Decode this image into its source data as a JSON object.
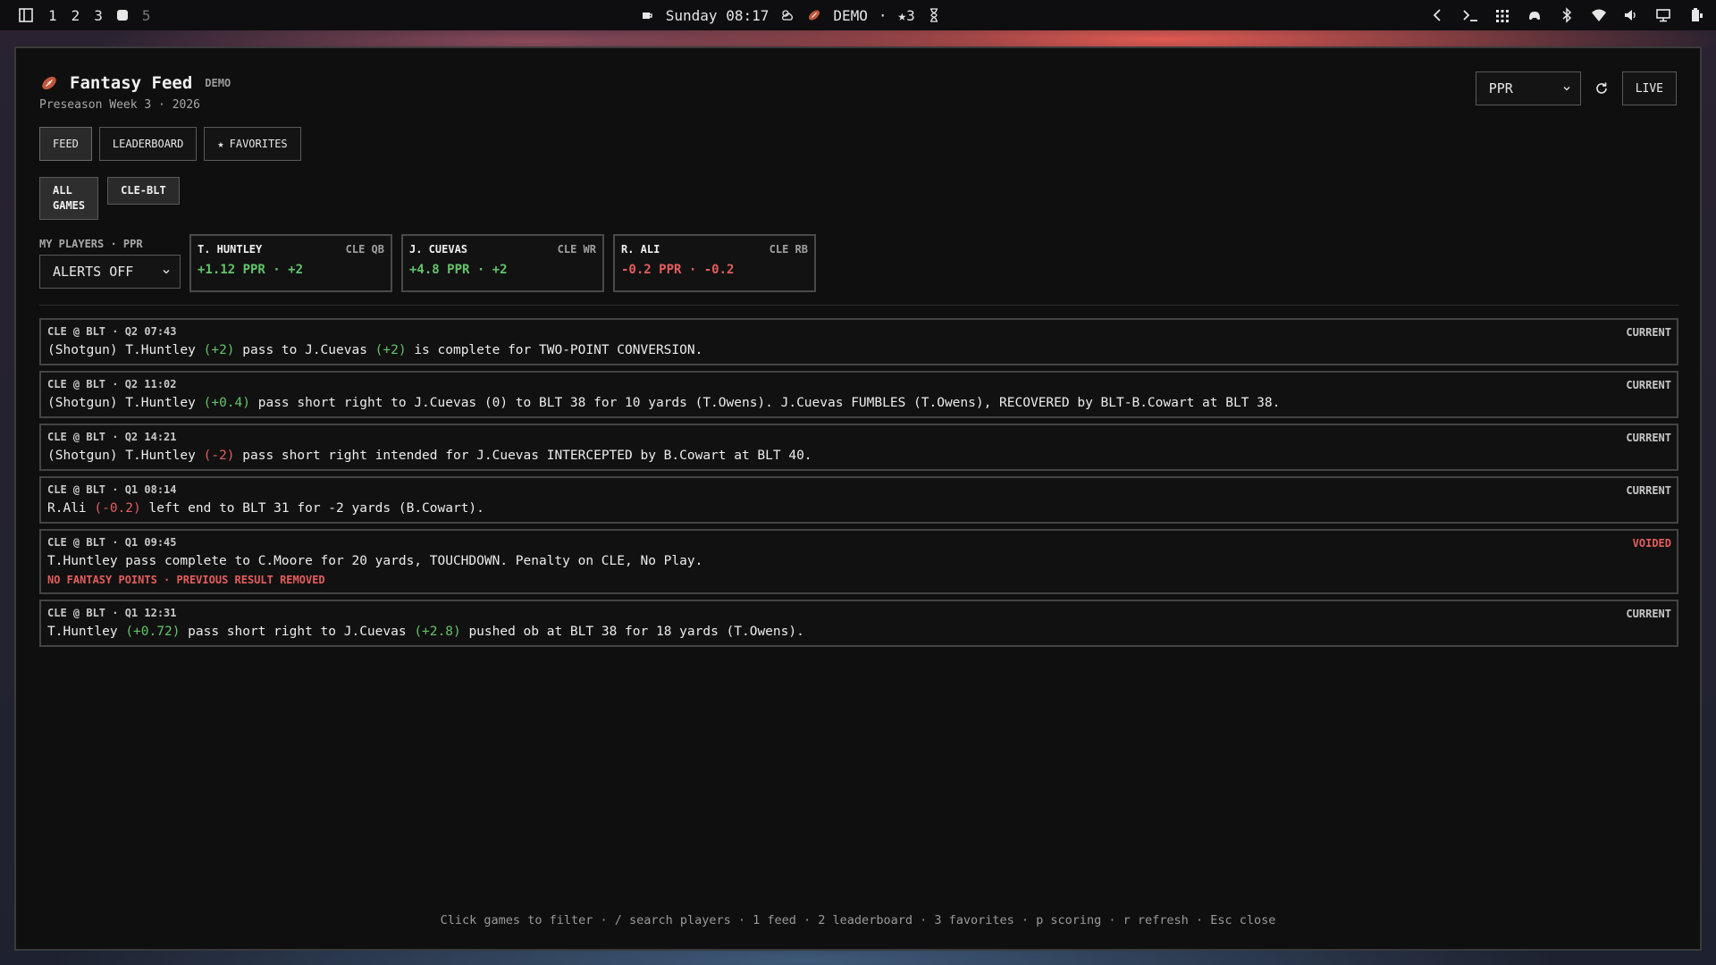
{
  "topbar": {
    "workspaces": [
      "1",
      "2",
      "3",
      "5"
    ],
    "clock": "Sunday 08:17",
    "app_status": "DEMO",
    "favorites_count": "★3"
  },
  "app": {
    "title": "Fantasy Feed",
    "demo_tag": "DEMO",
    "subtitle": "Preseason Week 3 · 2026",
    "tabs": {
      "feed": "FEED",
      "leaderboard": "LEADERBOARD",
      "favorites": "FAVORITES"
    },
    "game_filters": {
      "all_line1": "ALL",
      "all_line2": "GAMES",
      "game": "CLE-BLT"
    },
    "scoring_select": "PPR",
    "live_label": "LIVE",
    "my_players_label": "MY PLAYERS · PPR",
    "alerts_select": "ALERTS OFF",
    "players": [
      {
        "name": "T. HUNTLEY",
        "pos": "CLE QB",
        "points": "+1.12 PPR · +2",
        "sign": "pos"
      },
      {
        "name": "J. CUEVAS",
        "pos": "CLE WR",
        "points": "+4.8 PPR · +2",
        "sign": "pos"
      },
      {
        "name": "R. ALI",
        "pos": "CLE RB",
        "points": "-0.2 PPR · -0.2",
        "sign": "neg"
      }
    ],
    "plays": [
      {
        "meta": "CLE @ BLT · Q2  07:43",
        "status": "CURRENT",
        "parts": [
          {
            "t": "(Shotgun) T.Huntley "
          },
          {
            "t": "(+2)",
            "c": "pos"
          },
          {
            "t": " pass to J.Cuevas "
          },
          {
            "t": "(+2)",
            "c": "pos"
          },
          {
            "t": " is complete for TWO-POINT CONVERSION."
          }
        ]
      },
      {
        "meta": "CLE @ BLT · Q2  11:02",
        "status": "CURRENT",
        "parts": [
          {
            "t": "(Shotgun) T.Huntley "
          },
          {
            "t": "(+0.4)",
            "c": "pos"
          },
          {
            "t": " pass short right to J.Cuevas (0) to BLT 38 for 10 yards (T.Owens). J.Cuevas FUMBLES (T.Owens), RECOVERED by BLT-B.Cowart at BLT 38."
          }
        ]
      },
      {
        "meta": "CLE @ BLT · Q2  14:21",
        "status": "CURRENT",
        "parts": [
          {
            "t": "(Shotgun) T.Huntley "
          },
          {
            "t": "(-2)",
            "c": "neg"
          },
          {
            "t": " pass short right intended for J.Cuevas INTERCEPTED by B.Cowart at BLT 40."
          }
        ]
      },
      {
        "meta": "CLE @ BLT · Q1  08:14",
        "status": "CURRENT",
        "parts": [
          {
            "t": "R.Ali "
          },
          {
            "t": "(-0.2)",
            "c": "neg"
          },
          {
            "t": " left end to BLT 31 for -2 yards (B.Cowart)."
          }
        ]
      },
      {
        "meta": "CLE @ BLT · Q1  09:45",
        "status": "VOIDED",
        "parts": [
          {
            "t": "T.Huntley pass complete to C.Moore for 20 yards, TOUCHDOWN. Penalty on CLE, No Play."
          }
        ],
        "note": "NO FANTASY POINTS · PREVIOUS RESULT REMOVED"
      },
      {
        "meta": "CLE @ BLT · Q1  12:31",
        "status": "CURRENT",
        "parts": [
          {
            "t": "T.Huntley "
          },
          {
            "t": "(+0.72)",
            "c": "pos"
          },
          {
            "t": " pass short right to J.Cuevas "
          },
          {
            "t": "(+2.8)",
            "c": "pos"
          },
          {
            "t": " pushed ob at BLT 38 for 18 yards (T.Owens)."
          }
        ]
      }
    ],
    "footer": "Click games to filter · / search players · 1 feed · 2 leaderboard · 3 favorites · p scoring · r refresh · Esc close"
  },
  "colors": {
    "positive": "#62c46a",
    "negative": "#e55d5d",
    "background": "#0f0f0f"
  },
  "icons": [
    "football-icon",
    "refresh-icon",
    "star-icon",
    "chevron-down-icon",
    "wifi-icon",
    "bluetooth-icon",
    "volume-icon",
    "battery-icon"
  ]
}
